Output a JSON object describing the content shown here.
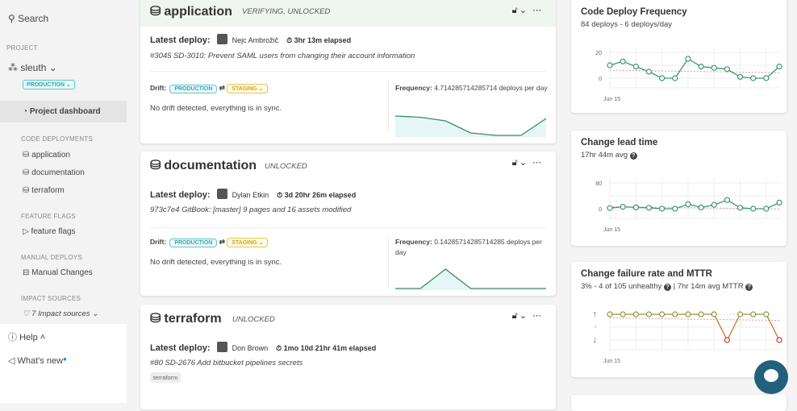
{
  "sidebar": {
    "search": "Search",
    "project_label": "PROJECT",
    "project": "sleuth",
    "env": "PRODUCTION",
    "dashboard": "Project dashboard",
    "code_deployments_label": "CODE DEPLOYMENTS",
    "code_deployments": [
      "application",
      "documentation",
      "terraform"
    ],
    "feature_flags_label": "FEATURE FLAGS",
    "feature_flags": "feature flags",
    "manual_label": "MANUAL DEPLOYS",
    "manual": "Manual Changes",
    "impact_label": "IMPACT SOURCES",
    "impact": "7 Impact sources",
    "help": "Help",
    "whats_new": "What's new"
  },
  "deployments": [
    {
      "name": "application",
      "status": "VERIFYING, UNLOCKED",
      "latest_label": "Latest deploy:",
      "author": "Nejc Ambrožič",
      "elapsed": "3hr 13m elapsed",
      "message": "#3045 SD-3010: Prevent SAML users from changing their account information",
      "drift_label": "Drift:",
      "from": "PRODUCTION",
      "to": "STAGING",
      "sync": "No drift detected, everything is in sync.",
      "freq_label": "Frequency:",
      "freq": "4.714285714285714 deploys per day",
      "spark": [
        8,
        7.5,
        6,
        1,
        0,
        0,
        7
      ]
    },
    {
      "name": "documentation",
      "status": "UNLOCKED",
      "latest_label": "Latest deploy:",
      "author": "Dylan Etkin",
      "elapsed": "3d 20hr 26m elapsed",
      "message": "973c7e4 GitBook: [master] 9 pages and 16 assets modified",
      "drift_label": "Drift:",
      "from": "PRODUCTION",
      "to": "STAGING",
      "sync": "No drift detected, everything is in sync.",
      "freq_label": "Frequency:",
      "freq": "0.14285714285714285 deploys per day",
      "spark": [
        0,
        0,
        1,
        0,
        0,
        0,
        0
      ]
    },
    {
      "name": "terraform",
      "status": "UNLOCKED",
      "latest_label": "Latest deploy:",
      "author": "Don Brown",
      "elapsed": "1mo 10d 21hr 41m elapsed",
      "message": "#80 SD-2676 Add bitbucket pipelines secrets",
      "tag": "terraform"
    }
  ],
  "metrics": [
    {
      "title": "Code Deploy Frequency",
      "subtitle": "84 deploys - 6 deploys/day"
    },
    {
      "title": "Change lead time",
      "subtitle": "17hr 44m avg"
    },
    {
      "title": "Change failure rate and MTTR",
      "subtitle_a": "3% - 4 of 105 unhealthy",
      "subtitle_b": "| 7hr 14m avg MTTR"
    }
  ],
  "chart_data": [
    {
      "type": "line",
      "title": "Code Deploy Frequency",
      "xlabel": "Jun 15",
      "yticks": [
        "20",
        "0"
      ],
      "ylim": [
        0,
        20
      ],
      "values": [
        10,
        13,
        9,
        5,
        0,
        0,
        15,
        9,
        8,
        7,
        1,
        0,
        0,
        9
      ],
      "color": "#3a9a6e"
    },
    {
      "type": "line",
      "title": "Change lead time",
      "xlabel": "Jun 15",
      "yticks": [
        "80",
        "0"
      ],
      "ylim": [
        0,
        80
      ],
      "values": [
        2,
        6,
        4,
        3,
        0,
        0,
        14,
        4,
        12,
        27,
        3,
        0,
        0,
        19
      ],
      "color": "#3a9a6e"
    },
    {
      "type": "line",
      "title": "Change failure rate and MTTR",
      "xlabel": "Jun 15",
      "yticks": [
        "↑",
        "·",
        "↓"
      ],
      "ylim": [
        0,
        1
      ],
      "values": [
        1,
        1,
        1,
        1,
        1,
        1,
        1,
        1,
        1,
        0,
        1,
        1,
        1,
        0
      ],
      "color": "#8a9a3a",
      "bad_color": "#c0392b"
    }
  ]
}
